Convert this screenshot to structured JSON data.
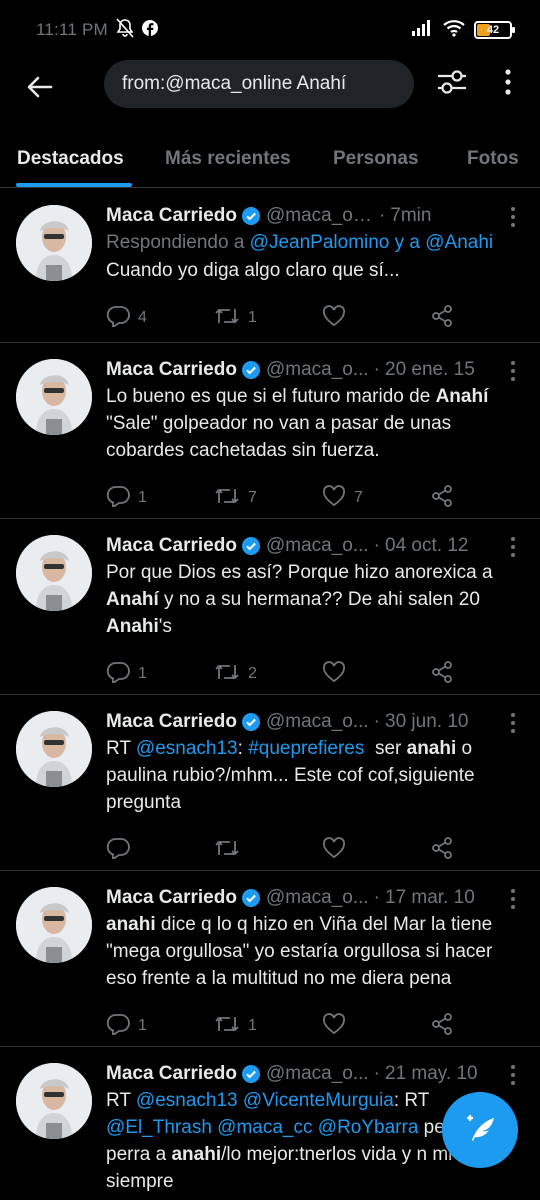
{
  "status_bar": {
    "time": "11:11 PM",
    "battery_level": 42,
    "battery_label": "42",
    "battery_color": "#f0a020"
  },
  "header": {
    "search_query": "from:@maca_online Anahí",
    "back_icon": "arrow-left-icon",
    "filter_icon": "sliders-icon",
    "more_icon": "more-vertical-icon"
  },
  "tabs": [
    {
      "label": "Destacados",
      "active": true
    },
    {
      "label": "Más recientes",
      "active": false
    },
    {
      "label": "Personas",
      "active": false
    },
    {
      "label": "Fotos",
      "active": false
    }
  ],
  "accent_color": "#1d9bf0",
  "tweets": [
    {
      "name": "Maca Carriedo",
      "handle": "@maca_online",
      "time": "7min",
      "reply_prefix": "Respondiendo a ",
      "reply_to": "@JeanPalomino y a @Anahi",
      "text": "Cuando yo diga algo claro que sí...",
      "replies": "4",
      "retweets": "1",
      "likes": ""
    },
    {
      "name": "Maca Carriedo",
      "handle": "@maca_o...",
      "time": "20 ene. 15",
      "text_parts": [
        "Lo bueno es que si el futuro marido de ",
        "Anahí",
        " \"Sale\" golpeador no van a pasar de unas cobardes cachetadas sin fuerza."
      ],
      "replies": "1",
      "retweets": "7",
      "likes": "7"
    },
    {
      "name": "Maca Carriedo",
      "handle": "@maca_o...",
      "time": "04 oct. 12",
      "text_parts": [
        "Por que Dios es así? Porque hizo anorexica a ",
        "Anahí",
        " y no a su hermana?? De ahi salen 20 ",
        "Anahi",
        "'s"
      ],
      "replies": "1",
      "retweets": "2",
      "likes": ""
    },
    {
      "name": "Maca Carriedo",
      "handle": "@maca_o...",
      "time": "30 jun. 10",
      "text_parts": [
        "RT ",
        "@esnach13",
        ": ",
        "#queprefieres",
        "  ser ",
        "anahi",
        " o paulina rubio?/mhm... Este cof cof,siguiente pregunta"
      ],
      "replies": "",
      "retweets": "",
      "likes": ""
    },
    {
      "name": "Maca Carriedo",
      "handle": "@maca_o...",
      "time": "17 mar. 10",
      "text_parts": [
        "anahi",
        " dice q lo q hizo en Viña del Mar la tiene \"mega orgullosa\" yo estaría orgullosa si hacer eso frente a la multitud no me diera pena"
      ],
      "replies": "1",
      "retweets": "1",
      "likes": ""
    },
    {
      "name": "Maca Carriedo",
      "handle": "@maca_o...",
      "time": "21 may. 10",
      "text_parts": [
        "RT ",
        "@esnach13",
        " ",
        "@VicenteMurguia",
        ": RT ",
        "@El_Thrash",
        " ",
        "@maca_cc",
        " ",
        "@RoYbarra",
        " pe",
        " decirle perra a ",
        "anahi",
        "/lo mejor:tnerlos",
        " vida y n mi TL siempre"
      ],
      "replies": "",
      "retweets": "",
      "likes": ""
    }
  ],
  "fab_icon": "compose-feather-icon"
}
